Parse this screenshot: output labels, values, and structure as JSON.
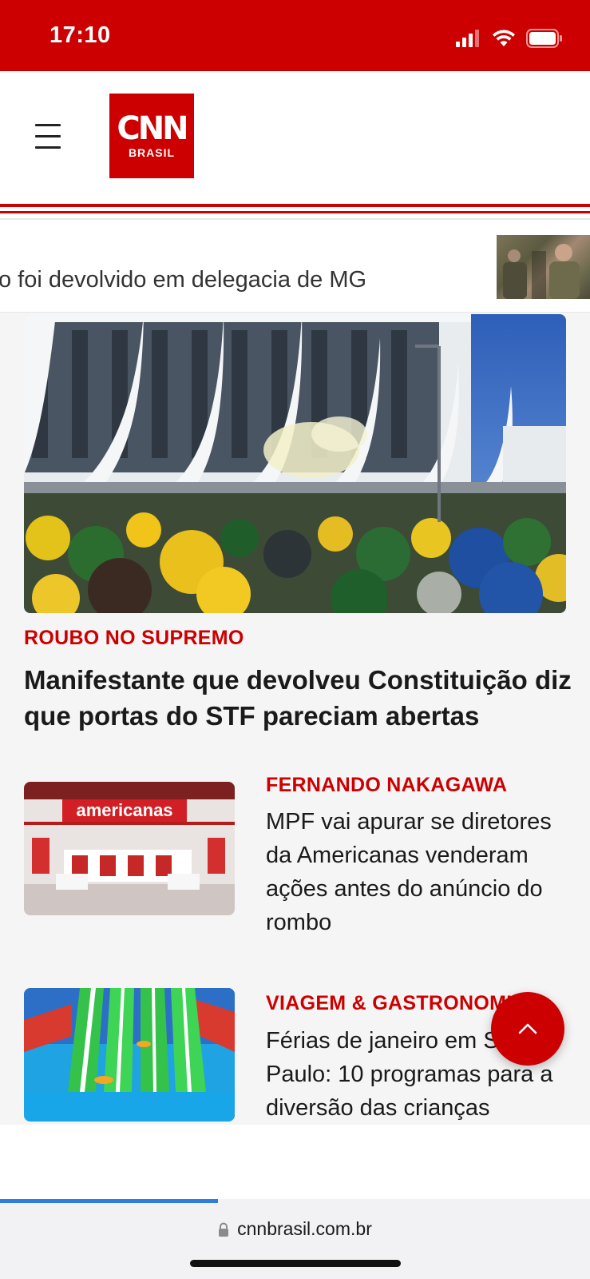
{
  "status_bar": {
    "time": "17:10"
  },
  "logo": {
    "main": "CNN",
    "sub": "BRASIL"
  },
  "ticker": {
    "text": "o foi devolvido em delegacia de MG"
  },
  "hero": {
    "kicker": "ROUBO NO SUPREMO",
    "title": "Manifestante que devolveu Constituição diz que portas do STF pareciam abertas"
  },
  "stories": [
    {
      "kicker": "FERNANDO NAKAGAWA",
      "title": "MPF vai apurar se diretores da Americanas venderam ações antes do anúncio do rombo",
      "thumb_text": "americanas"
    },
    {
      "kicker": "VIAGEM & GASTRONOMIA",
      "title": "Férias de janeiro em São Paulo: 10 programas para a diversão das crianças"
    }
  ],
  "browser": {
    "url": "cnnbrasil.com.br",
    "load_progress": 0.37
  },
  "colors": {
    "brand_red": "#cc0000",
    "progress_blue": "#2f7de1"
  }
}
